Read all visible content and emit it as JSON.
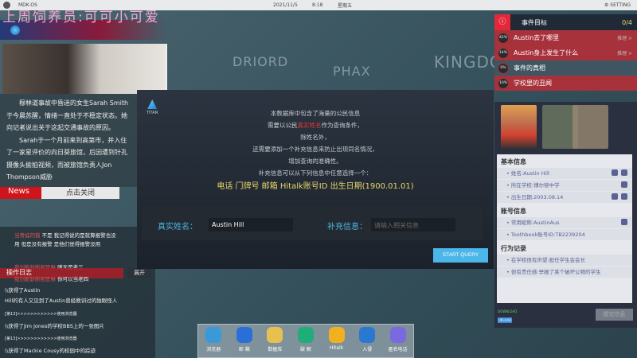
{
  "topbar": {
    "os": "MDK-OS",
    "date": "2021/11/5",
    "time": "8:18",
    "weekday": "星期五",
    "setting": "SETTING"
  },
  "watermark": "上周饲养员:可可小可爱",
  "map": {
    "regions": [
      "DRIORD",
      "PHAX",
      "KINGDOM"
    ]
  },
  "article": {
    "p1": "穆林道事故中昏迷的女生Sarah Smith于今晨苏醒，情绪一直处于不稳定状态。她向记者说出关于这起交通事故的原因。",
    "p2": "Sarah于一个月前来到高第市，并入住了一家星评价的向日葵旅馆，后因遭到针孔摄像头偷拍视频，而被旅馆负责人Jon Thompson威胁"
  },
  "news": {
    "label": "News",
    "close": "点击关闭"
  },
  "chat": {
    "messages": [
      {
        "user": "当青蛙的猫",
        "text": "不是 我记得说的是就算报警也没用 但是没有报警 是他们觉得报警没用"
      },
      {
        "user": "我剑能斩断相思嘛",
        "text": "晴天是老三"
      },
      {
        "user": "我剑能斩断相思嘛",
        "text": "你可以当老四"
      }
    ],
    "oplog": "操作日志",
    "expand": "展开",
    "log": [
      "\\\\获得了Austin",
      "Hill的有人又见到了Austin曾经教训过的独眼怪人",
      "[第13]>>>>>>>>>>>>使用浏览器",
      "\\\\获得了Jim Jones的学校BBS上的一张图片",
      "[第13]>>>>>>>>>>>>使用浏览器",
      "\\\\获得了Mackie Cousy的校园中的踪迹"
    ]
  },
  "dialog": {
    "brand": "TITAN",
    "lines": [
      "本数据库中包含了海量的公民信息"
    ],
    "l2a": "需要以公民",
    "l2hl": "真实姓名",
    "l2b": "作为查询条件，",
    "l3": "除姓名外，",
    "l4": "还需要添加一个补充信息来防止出现同名情况，",
    "l5": "增加查询的准确性。",
    "l6": "补充信息可以从下列信息中任意选择一个：",
    "options": "电话  门牌号  邮箱  Hitalk账号ID  出生日期(1900.01.01)",
    "name_label": "真实姓名：",
    "name_value": "Austin Hill",
    "extra_label": "补充信息：",
    "extra_placeholder": "请输入相关信息",
    "start": "START QUERY"
  },
  "objectives": {
    "title": "事件目标",
    "count": "0/4",
    "items": [
      {
        "pct": "42%",
        "text": "Austin去了哪里",
        "action": "推理 >",
        "color": "#a8323c"
      },
      {
        "pct": "14%",
        "text": "Austin身上发生了什么",
        "action": "推理 >",
        "color": "#a8323c"
      },
      {
        "pct": "0%",
        "text": "事件的真相",
        "action": "",
        "color": "#3e5562"
      },
      {
        "pct": "10%",
        "text": "学校里的丑闻",
        "action": "",
        "color": "#a8323c"
      }
    ]
  },
  "profile": {
    "portrait_name": "Austin Hill",
    "basic_title": "基本信息",
    "basic": [
      "姓名:Austin Hill",
      "所在学校:博尔顿中学",
      "出生日期:2003.08.14"
    ],
    "account_title": "账号信息",
    "account": [
      "常用昵称:AustinAus",
      "Toothbook账号ID:TB2239204"
    ],
    "behavior_title": "行为记录",
    "behavior": [
      "在学校很有声望:担任学生会会长",
      "很有责任感:举报了某个破坏公物的学生"
    ],
    "submit": "提交信息",
    "download": "DOWNLOAD",
    "upload": "UPLOAD"
  },
  "dock": [
    {
      "label": "浏览器",
      "color": "#3a9ad8"
    },
    {
      "label": "邮 箱",
      "color": "#2a6fd8"
    },
    {
      "label": "数据库",
      "color": "#e8c050"
    },
    {
      "label": "破 解",
      "color": "#1fae78"
    },
    {
      "label": "Hitalk",
      "color": "#f0b020"
    },
    {
      "label": "入侵",
      "color": "#2a78d0"
    },
    {
      "label": "匿名电话",
      "color": "#7a6ae0"
    }
  ]
}
